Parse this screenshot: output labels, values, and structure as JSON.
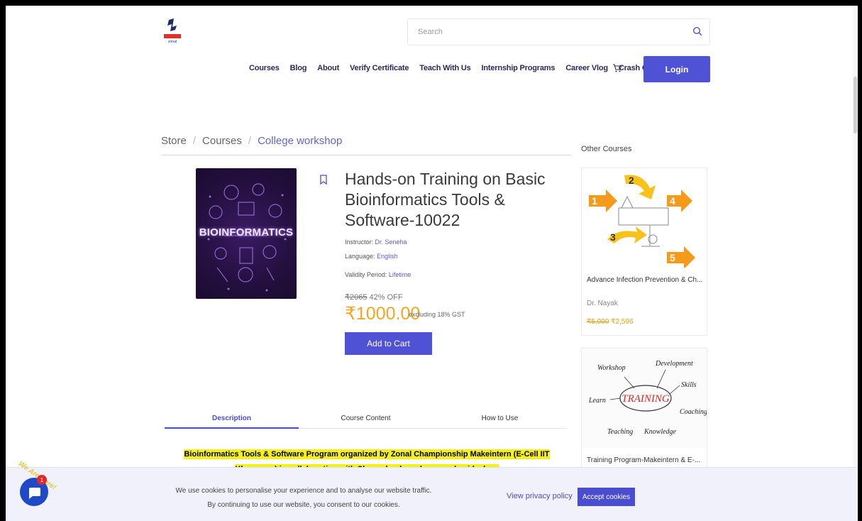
{
  "header": {
    "logo_name": "Zonal Championship logo",
    "search_placeholder": "Search",
    "nav": [
      "Courses",
      "Blog",
      "About",
      "Verify Certificate",
      "Teach With Us",
      "Internship Programs",
      "Career Vlog",
      "Crash Courses"
    ],
    "login_label": "Login"
  },
  "breadcrumb": [
    "Store",
    "Courses",
    "College workshop"
  ],
  "product": {
    "image_text": "BIOINFORMATICS",
    "title": "Hands-on Training on Basic Bioinformatics Tools & Software-10022",
    "instructor_label": "Instructor:",
    "instructor": "Dr. Seneha",
    "language_label": "Language:",
    "language": "English",
    "validity_label": "Validity Period:",
    "validity": "Lifetime",
    "old_price": "₹2065",
    "discount": "42% OFF",
    "price": "₹1000.00",
    "gst_note": "excluding 18% GST",
    "add_to_cart": "Add to Cart"
  },
  "tabs": [
    "Description",
    "Course Content",
    "How to Use"
  ],
  "description": "Bioinformatics Tools & Software Program organized by Zonal Championship Makeintern (E-Cell IIT Kharagpur) in collaboration with Shree shankaracharya mahavidyalaya",
  "sidebar": {
    "title": "Other Courses",
    "cards": [
      {
        "title": "Advance Infection Prevention & Ch...",
        "author": "Dr. Nayak",
        "old_price": "₹5,000",
        "price": "₹2,596"
      },
      {
        "title": "Training Program-Makeintern & E-..."
      }
    ]
  },
  "cookie": {
    "line1": "We use cookies to personalise your experience and to analyse our website traffic.",
    "line2": "By continuing to use our website, you consent to our cookies.",
    "privacy": "View privacy policy",
    "accept": "Accept cookies"
  },
  "chat": {
    "tag": "We Are Here!",
    "badge": "1"
  },
  "colors": {
    "accent": "#5052d5",
    "price": "#f5a623",
    "highlight": "#f6f01a"
  }
}
